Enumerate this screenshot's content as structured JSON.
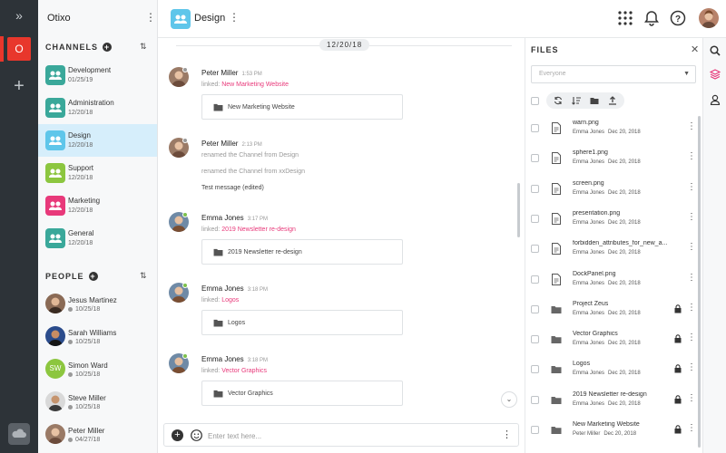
{
  "rail": {
    "collapse_icon": "double-chevron-right-icon",
    "org_badge": "O",
    "add_icon": "plus-icon",
    "cloud_icon": "cloud-icon",
    "accent": "#e8372c"
  },
  "sidebar": {
    "org_name": "Otixo",
    "channels_title": "CHANNELS",
    "people_title": "PEOPLE",
    "channels": [
      {
        "name": "Development",
        "date": "01/25/19",
        "color": "#3aa89a"
      },
      {
        "name": "Administration",
        "date": "12/20/18",
        "color": "#3aa89a"
      },
      {
        "name": "Design",
        "date": "12/20/18",
        "color": "#5fc6ea",
        "active": true
      },
      {
        "name": "Support",
        "date": "12/20/18",
        "color": "#8cc63f"
      },
      {
        "name": "Marketing",
        "date": "12/20/18",
        "color": "#e8397a"
      },
      {
        "name": "General",
        "date": "12/20/18",
        "color": "#3aa89a"
      }
    ],
    "people": [
      {
        "name": "Jesus Martinez",
        "date": "10/25/18"
      },
      {
        "name": "Sarah Williams",
        "date": "10/25/18"
      },
      {
        "name": "Simon Ward",
        "date": "10/25/18",
        "initials": "SW"
      },
      {
        "name": "Steve Miller",
        "date": "10/25/18"
      },
      {
        "name": "Peter Miller",
        "date": "04/27/18"
      }
    ]
  },
  "topbar": {
    "channel_title": "Design",
    "icons": [
      "apps-grid-icon",
      "bell-icon",
      "help-icon"
    ]
  },
  "messages": {
    "date_divider": "12/20/18",
    "items": [
      {
        "author": "Peter Miller",
        "time": "1:53 PM",
        "linked_prefix": "linked:",
        "linked": "New Marketing Website",
        "card": "New Marketing Website"
      },
      {
        "author": "Peter Miller",
        "time": "2:13 PM",
        "line1": "renamed the Channel from Design",
        "line2": "renamed the Channel from xxDesign",
        "line3": "Test message (edited)"
      },
      {
        "author": "Emma Jones",
        "time": "3:17 PM",
        "linked_prefix": "linked:",
        "linked": "2019 Newsletter re-design",
        "card": "2019 Newsletter re-design"
      },
      {
        "author": "Emma Jones",
        "time": "3:18 PM",
        "linked_prefix": "linked:",
        "linked": "Logos",
        "card": "Logos"
      },
      {
        "author": "Emma Jones",
        "time": "3:18 PM",
        "linked_prefix": "linked:",
        "linked": "Vector Graphics",
        "card": "Vector Graphics"
      }
    ],
    "composer_placeholder": "Enter text here..."
  },
  "files": {
    "title": "FILES",
    "filter_placeholder": "Everyone",
    "rows": [
      {
        "name": "warn.png",
        "author": "Emma Jones",
        "date": "Dec 20, 2018",
        "kind": "file"
      },
      {
        "name": "sphere1.png",
        "author": "Emma Jones",
        "date": "Dec 20, 2018",
        "kind": "file"
      },
      {
        "name": "screen.png",
        "author": "Emma Jones",
        "date": "Dec 20, 2018",
        "kind": "file"
      },
      {
        "name": "presentation.png",
        "author": "Emma Jones",
        "date": "Dec 20, 2018",
        "kind": "file"
      },
      {
        "name": "forbidden_attributes_for_new_a...",
        "author": "Emma Jones",
        "date": "Dec 20, 2018",
        "kind": "file"
      },
      {
        "name": "DockPanel.png",
        "author": "Emma Jones",
        "date": "Dec 20, 2018",
        "kind": "file"
      },
      {
        "name": "Project Zeus",
        "author": "Emma Jones",
        "date": "Dec 20, 2018",
        "kind": "folder",
        "locked": true
      },
      {
        "name": "Vector Graphics",
        "author": "Emma Jones",
        "date": "Dec 20, 2018",
        "kind": "folder",
        "locked": true
      },
      {
        "name": "Logos",
        "author": "Emma Jones",
        "date": "Dec 20, 2018",
        "kind": "folder",
        "locked": true
      },
      {
        "name": "2019 Newsletter re-design",
        "author": "Emma Jones",
        "date": "Dec 20, 2018",
        "kind": "folder",
        "locked": true
      },
      {
        "name": "New Marketing Website",
        "author": "Peter Miller",
        "date": "Dec 20, 2018",
        "kind": "folder",
        "locked": true
      }
    ]
  },
  "right_rail": {
    "icons": [
      "search-icon",
      "layers-icon",
      "user-icon"
    ],
    "active_color": "#e8397a"
  }
}
